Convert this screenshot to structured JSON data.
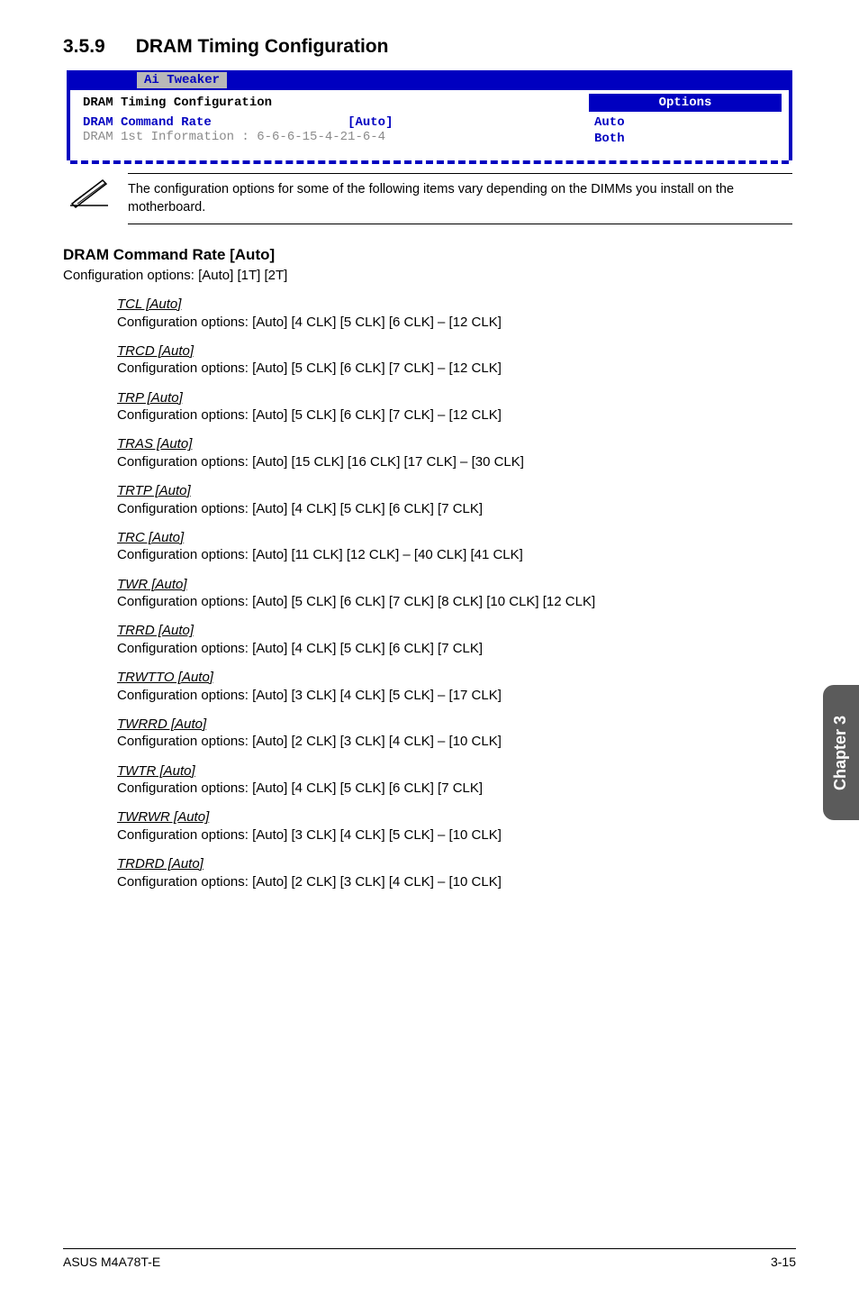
{
  "section": {
    "number": "3.5.9",
    "title": "DRAM Timing Configuration"
  },
  "bios": {
    "tab": "Ai Tweaker",
    "panel_title": "DRAM Timing Configuration",
    "cmd_rate_label": "DRAM Command Rate",
    "cmd_rate_value": "[Auto]",
    "info_line": "DRAM 1st Information : 6-6-6-15-4-21-6-4",
    "options_header": "Options",
    "options": {
      "opt0": "Auto",
      "opt1": "Both"
    }
  },
  "note": "The configuration options for some of the following items vary depending on the DIMMs you install on the motherboard.",
  "cmd_rate": {
    "heading": "DRAM Command Rate [Auto]",
    "conf": "Configuration options: [Auto] [1T] [2T]"
  },
  "params": {
    "tcl": {
      "title": "TCL [Auto]",
      "conf": "Configuration options: [Auto] [4 CLK] [5 CLK] [6 CLK] – [12 CLK]"
    },
    "trcd": {
      "title": "TRCD [Auto]",
      "conf": "Configuration options: [Auto] [5 CLK] [6 CLK] [7 CLK] – [12 CLK]"
    },
    "trp": {
      "title": "TRP [Auto]",
      "conf": "Configuration options: [Auto] [5 CLK] [6 CLK] [7 CLK] – [12 CLK]"
    },
    "tras": {
      "title": "TRAS [Auto]",
      "conf": "Configuration options: [Auto] [15 CLK] [16 CLK] [17 CLK] – [30 CLK]"
    },
    "trtp": {
      "title": "TRTP [Auto]",
      "conf": "Configuration options: [Auto] [4 CLK] [5 CLK] [6 CLK] [7 CLK]"
    },
    "trc": {
      "title": "TRC [Auto]",
      "conf": "Configuration options: [Auto] [11 CLK] [12 CLK] – [40 CLK] [41 CLK]"
    },
    "twr": {
      "title": "TWR [Auto]",
      "conf": "Configuration options: [Auto] [5 CLK] [6 CLK] [7 CLK] [8 CLK] [10 CLK] [12 CLK]"
    },
    "trrd": {
      "title": "TRRD [Auto]",
      "conf": "Configuration options: [Auto] [4 CLK] [5 CLK] [6 CLK] [7 CLK]"
    },
    "trwtto": {
      "title": "TRWTTO [Auto]",
      "conf": "Configuration options: [Auto] [3 CLK] [4 CLK] [5 CLK] – [17 CLK]"
    },
    "twrrd": {
      "title": "TWRRD [Auto]",
      "conf": "Configuration options: [Auto] [2 CLK] [3 CLK] [4 CLK] – [10 CLK]"
    },
    "twtr": {
      "title": "TWTR [Auto]",
      "conf": "Configuration options: [Auto] [4 CLK] [5 CLK] [6 CLK] [7 CLK]"
    },
    "twrwr": {
      "title": "TWRWR [Auto]",
      "conf": "Configuration options: [Auto] [3 CLK] [4 CLK] [5 CLK] – [10 CLK]"
    },
    "trdrd": {
      "title": "TRDRD [Auto]",
      "conf": "Configuration options: [Auto] [2 CLK] [3 CLK] [4 CLK] – [10 CLK]"
    }
  },
  "side_tab": "Chapter 3",
  "footer": {
    "left": "ASUS M4A78T-E",
    "right": "3-15"
  }
}
